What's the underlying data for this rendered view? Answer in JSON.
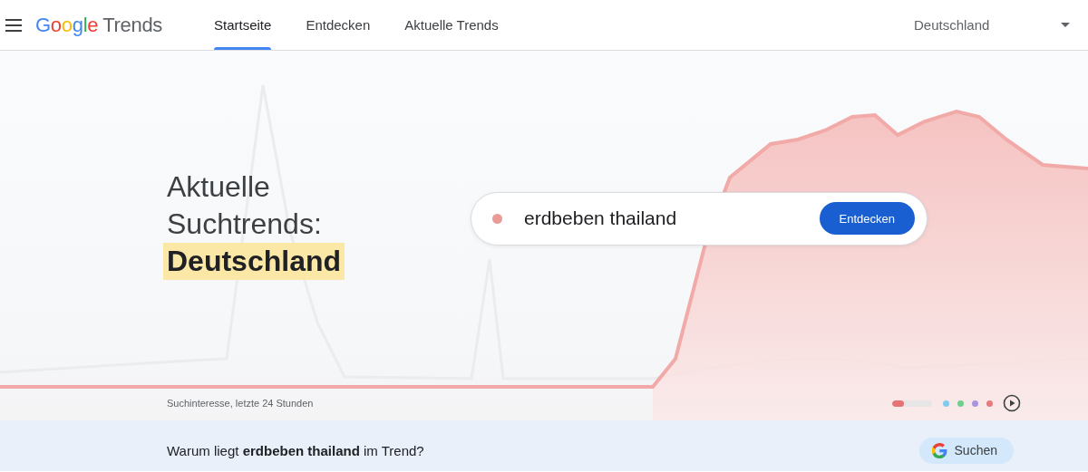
{
  "header": {
    "logo": {
      "brand": "Google",
      "product": "Trends"
    },
    "tabs": [
      {
        "label": "Startseite",
        "selected": true
      },
      {
        "label": "Entdecken",
        "selected": false
      },
      {
        "label": "Aktuelle Trends",
        "selected": false
      }
    ],
    "country": "Deutschland"
  },
  "hero": {
    "heading": "Aktuelle Suchtrends:",
    "highlight": "Deutschland",
    "search": {
      "value": "erdbeben thailand",
      "color": "#ea9a97",
      "button": "Entdecken"
    },
    "caption": "Suchinteresse, letzte 24 Stunden",
    "slides": [
      {
        "color": "#e57373",
        "selected": true,
        "level": 0.3
      },
      {
        "color": "#81c9ef",
        "selected": false
      },
      {
        "color": "#6fcf8f",
        "selected": false
      },
      {
        "color": "#a994e0",
        "selected": false
      },
      {
        "color": "#e57b7b",
        "selected": false
      }
    ]
  },
  "footer": {
    "question": "Warum liegt **erdbeben thailand** im Trend?",
    "button": "Suchen"
  }
}
